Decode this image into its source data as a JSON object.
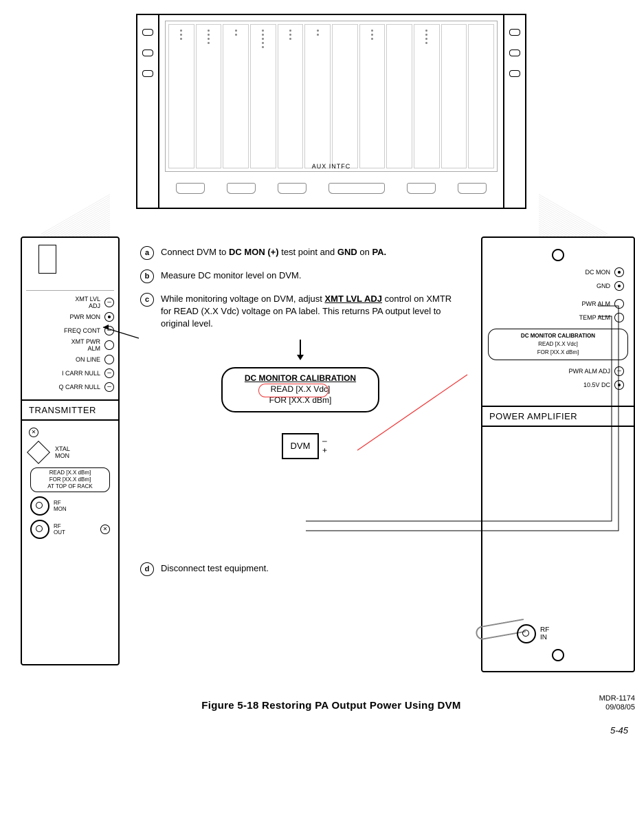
{
  "rack": {
    "aux_label": "AUX INTFC"
  },
  "transmitter": {
    "title": "TRANSMITTER",
    "labels": {
      "xmt_lvl_adj_l1": "XMT LVL",
      "xmt_lvl_adj_l2": "ADJ",
      "pwr_mon": "PWR MON",
      "freq_cont": "FREQ CONT",
      "xmt_pwr_alm_l1": "XMT PWR",
      "xmt_pwr_alm_l2": "ALM",
      "on_line": "ON LINE",
      "i_carr_null": "I CARR NULL",
      "q_carr_null": "Q CARR NULL",
      "xtal_mon_l1": "XTAL",
      "xtal_mon_l2": "MON",
      "read_pill_l1": "READ [X.X dBm]",
      "read_pill_l2": "FOR [XX.X dBm]",
      "read_pill_l3": "AT TOP OF RACK",
      "rf_mon_l1": "RF",
      "rf_mon_l2": "MON",
      "rf_out_l1": "RF",
      "rf_out_l2": "OUT"
    }
  },
  "power_amp": {
    "title": "POWER AMPLIFIER",
    "labels": {
      "dc_mon": "DC MON",
      "gnd": "GND",
      "pwr_alm": "PWR ALM",
      "temp_alm": "TEMP ALM",
      "pwr_alm_adj": "PWR ALM ADJ",
      "ten5v": "10.5V DC",
      "rf_in_l1": "RF",
      "rf_in_l2": "IN"
    },
    "cal": {
      "l1": "DC MONITOR CALIBRATION",
      "l2": "READ [X.X Vdc]",
      "l3": "FOR [XX.X dBm]"
    }
  },
  "steps": {
    "a": {
      "letter": "a",
      "pre": "Connect DVM to ",
      "b1": "DC MON (+)",
      "mid": " test point  and ",
      "b2": "GND",
      "mid2": " on ",
      "b3": "PA."
    },
    "b": {
      "letter": "b",
      "text": "Measure DC monitor level on DVM."
    },
    "c": {
      "letter": "c",
      "pre": "While monitoring voltage on DVM, adjust ",
      "u1": "XMT LVL ADJ",
      "mid": " control on XMTR for READ (X.X Vdc) voltage on PA label. This returns PA output level to original level."
    },
    "d": {
      "letter": "d",
      "text": "Disconnect test equipment."
    }
  },
  "big_cal": {
    "l1": "DC MONITOR CALIBRATION",
    "l2": "READ [X.X Vdc]",
    "l3": "FOR [XX.X dBm]"
  },
  "dvm": {
    "label": "DVM",
    "minus": "–",
    "plus": "+"
  },
  "doc": {
    "id": "MDR-1174",
    "date": "09/08/05"
  },
  "caption": "Figure 5-18  Restoring PA Output Power Using DVM",
  "page": "5-45"
}
